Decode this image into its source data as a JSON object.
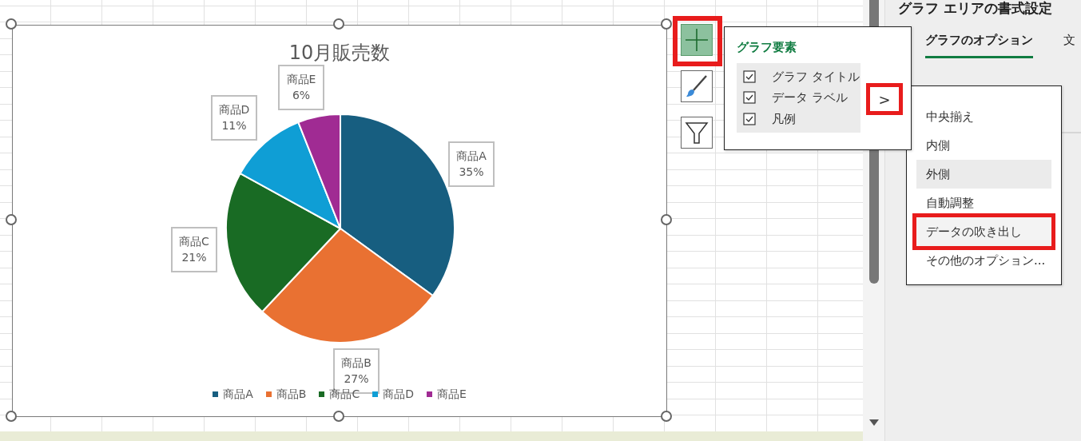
{
  "chart": {
    "chart_data": {
      "type": "pie",
      "title": "10月販売数",
      "categories": [
        "商品A",
        "商品B",
        "商品C",
        "商品D",
        "商品E"
      ],
      "values": [
        35,
        27,
        21,
        11,
        6
      ],
      "value_labels": [
        "35%",
        "27%",
        "21%",
        "11%",
        "6%"
      ]
    },
    "legend": [
      {
        "label": "商品A",
        "color": "#175e80"
      },
      {
        "label": "商品B",
        "color": "#e97132"
      },
      {
        "label": "商品C",
        "color": "#196b24"
      },
      {
        "label": "商品D",
        "color": "#0f9ed5"
      },
      {
        "label": "商品E",
        "color": "#a02b93"
      }
    ]
  },
  "chart_buttons": [
    {
      "kind": "plus",
      "selected": true,
      "annotated": true
    },
    {
      "kind": "brush",
      "selected": false,
      "annotated": false
    },
    {
      "kind": "filter",
      "selected": false,
      "annotated": false
    }
  ],
  "elements_menu": {
    "title": "グラフ要素",
    "items": [
      {
        "label": "グラフ タイトル",
        "checked": true
      },
      {
        "label": "データ ラベル",
        "checked": true
      },
      {
        "label": "凡例",
        "checked": true
      }
    ],
    "submenu_arrow": {
      "text": ">",
      "annotated": true
    }
  },
  "submenu": [
    {
      "label": "中央揃え",
      "selected": false,
      "annotated": false
    },
    {
      "label": "内側",
      "selected": false,
      "annotated": false
    },
    {
      "label": "外側",
      "selected": true,
      "annotated": false
    },
    {
      "label": "自動調整",
      "selected": false,
      "annotated": false
    },
    {
      "label": "データの吹き出し",
      "selected": false,
      "annotated": true
    },
    {
      "label": "その他のオプション...",
      "selected": false,
      "annotated": false
    }
  ],
  "format_pane": {
    "title": "グラフ エリアの書式設定",
    "tabs": [
      {
        "label": "グラフのオプション",
        "selected": true
      },
      {
        "label": "文",
        "selected": false
      }
    ]
  }
}
